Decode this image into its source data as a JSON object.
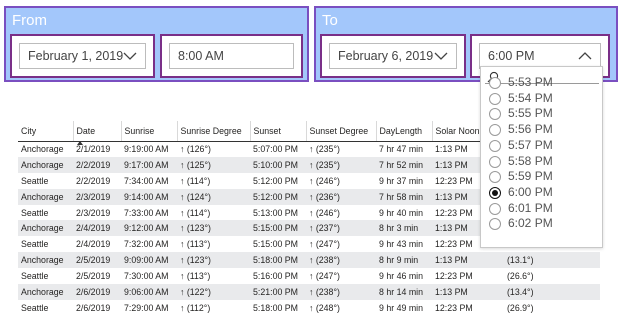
{
  "from": {
    "title": "From",
    "date": "February 1, 2019",
    "time": "8:00 AM"
  },
  "to": {
    "title": "To",
    "date": "February 6, 2019",
    "time": "6:00 PM"
  },
  "table": {
    "columns": [
      "City",
      "Date",
      "Sunrise",
      "Sunrise Degree",
      "Sunset",
      "Sunset Degree",
      "DayLength",
      "Solar Noon",
      ""
    ],
    "rows": [
      [
        "Anchorage",
        "2/1/2019",
        "9:19:00 AM",
        "↑ (126°)",
        "5:07:00 PM",
        "↑ (235°)",
        "7 hr 47 min",
        "1:13 PM",
        ""
      ],
      [
        "Anchorage",
        "2/2/2019",
        "9:17:00 AM",
        "↑ (125°)",
        "5:10:00 PM",
        "↑ (235°)",
        "7 hr 52 min",
        "1:13 PM",
        ""
      ],
      [
        "Seattle",
        "2/2/2019",
        "7:34:00 AM",
        "↑ (114°)",
        "5:12:00 PM",
        "↑ (246°)",
        "9 hr 37 min",
        "12:23 PM",
        ""
      ],
      [
        "Anchorage",
        "2/3/2019",
        "9:14:00 AM",
        "↑ (124°)",
        "5:12:00 PM",
        "↑ (236°)",
        "7 hr 58 min",
        "1:13 PM",
        ""
      ],
      [
        "Seattle",
        "2/3/2019",
        "7:33:00 AM",
        "↑ (114°)",
        "5:13:00 PM",
        "↑ (246°)",
        "9 hr 40 min",
        "12:23 PM",
        ""
      ],
      [
        "Anchorage",
        "2/4/2019",
        "9:12:00 AM",
        "↑ (123°)",
        "5:15:00 PM",
        "↑ (237°)",
        "8 hr 3 min",
        "1:13 PM",
        ""
      ],
      [
        "Seattle",
        "2/4/2019",
        "7:32:00 AM",
        "↑ (113°)",
        "5:15:00 PM",
        "↑ (247°)",
        "9 hr 43 min",
        "12:23 PM",
        ""
      ],
      [
        "Anchorage",
        "2/5/2019",
        "9:09:00 AM",
        "↑ (123°)",
        "5:18:00 PM",
        "↑ (238°)",
        "8 hr 9 min",
        "1:13 PM",
        "(13.1°)"
      ],
      [
        "Seattle",
        "2/5/2019",
        "7:30:00 AM",
        "↑ (113°)",
        "5:16:00 PM",
        "↑ (247°)",
        "9 hr 46 min",
        "12:23 PM",
        "(26.6°)"
      ],
      [
        "Anchorage",
        "2/6/2019",
        "9:06:00 AM",
        "↑ (122°)",
        "5:21:00 PM",
        "↑ (238°)",
        "8 hr 14 min",
        "1:13 PM",
        "(13.4°)"
      ],
      [
        "Seattle",
        "2/6/2019",
        "7:29:00 AM",
        "↑ (112°)",
        "5:18:00 PM",
        "↑ (248°)",
        "9 hr 49 min",
        "12:23 PM",
        "(26.9°)"
      ]
    ]
  },
  "dropdown": {
    "partial_top": "5:53 PM",
    "items": [
      "5:54 PM",
      "5:55 PM",
      "5:56 PM",
      "5:57 PM",
      "5:58 PM",
      "5:59 PM",
      "6:00 PM",
      "6:01 PM",
      "6:02 PM"
    ],
    "selected": "6:00 PM"
  },
  "colors": {
    "panel_bg": "#a3c7fb",
    "panel_border": "#7a4fc0",
    "box_border": "#7a2f88",
    "alt_row": "#e9eaec"
  }
}
